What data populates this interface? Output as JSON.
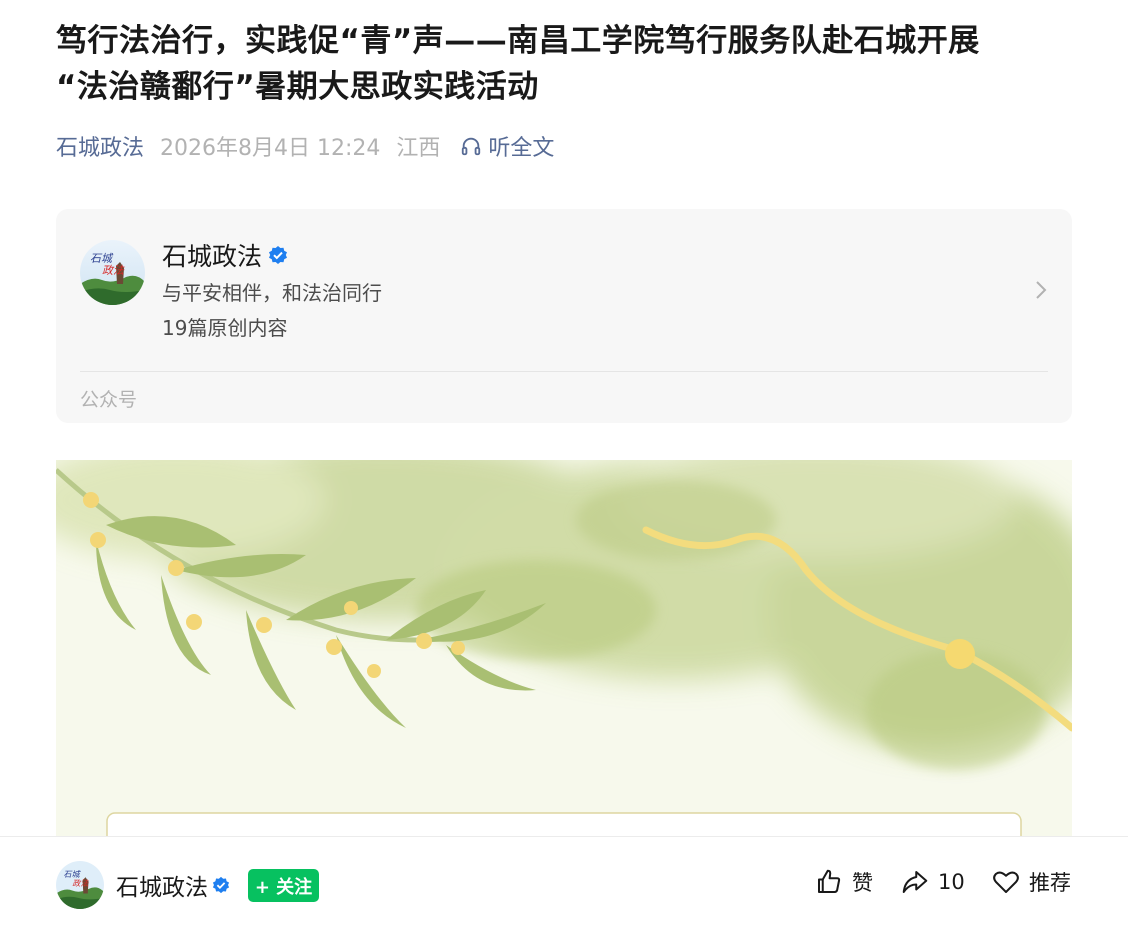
{
  "article": {
    "title_line1": "笃行法治行，实践促“青”声——南昌工学院笃行服务队赴石城开展",
    "title_line2": "“法治赣鄱行”暑期大思政实践活动"
  },
  "meta": {
    "account": "石城政法",
    "datetime": "2026年8月4日 12:24",
    "region": "江西",
    "listen_label": "听全文"
  },
  "profile_card": {
    "name": "石城政法",
    "slogan": "与平安相伴，和法治同行",
    "original_count": "19篇原创内容",
    "type_label": "公众号",
    "avatar_text": "石城政法"
  },
  "bottom_bar": {
    "account": "石城政法",
    "follow_label": "+ 关注",
    "like_label": "赞",
    "share_count": "10",
    "recommend_label": "推荐"
  },
  "colors": {
    "link": "#576b95",
    "muted": "#b2b2b2",
    "follow_green": "#07c160",
    "verified_blue": "#1f7ff0"
  },
  "icons": [
    "headphones-icon",
    "verified-icon",
    "chevron-right-icon",
    "thumbs-up-icon",
    "share-arrow-icon",
    "heart-icon"
  ]
}
